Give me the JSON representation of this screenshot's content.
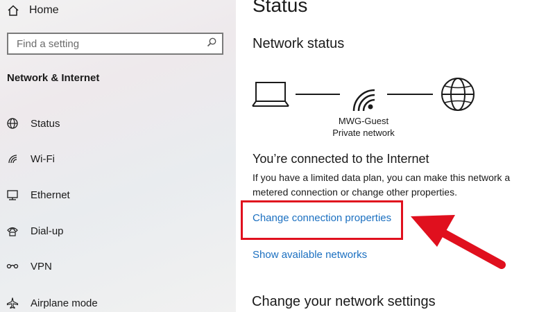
{
  "sidebar": {
    "home_label": "Home",
    "search": {
      "placeholder": "Find a setting",
      "value": ""
    },
    "section_title": "Network & Internet",
    "items": [
      {
        "label": "Status",
        "icon": "globe-icon"
      },
      {
        "label": "Wi-Fi",
        "icon": "wifi-icon"
      },
      {
        "label": "Ethernet",
        "icon": "ethernet-icon"
      },
      {
        "label": "Dial-up",
        "icon": "phone-icon"
      },
      {
        "label": "VPN",
        "icon": "vpn-icon"
      },
      {
        "label": "Airplane mode",
        "icon": "airplane-icon"
      }
    ]
  },
  "main": {
    "title": "Status",
    "network_status_heading": "Network status",
    "network_name": "MWG-Guest",
    "network_type": "Private network",
    "connected_heading": "You’re connected to the Internet",
    "connected_desc": "If you have a limited data plan, you can make this network a metered connection or change other properties.",
    "change_link": "Change connection properties",
    "show_link": "Show available networks",
    "change_settings_heading": "Change your network settings"
  },
  "colors": {
    "accent_link": "#1a6fc0",
    "highlight_red": "#e0101e"
  }
}
